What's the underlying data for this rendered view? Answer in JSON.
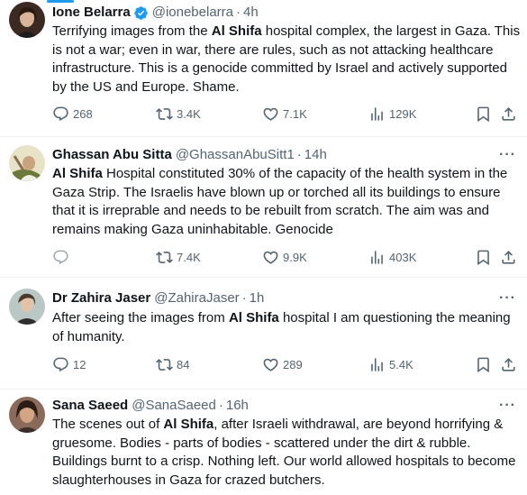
{
  "accent_color": "#1d9bf0",
  "text_color": "#0f1419",
  "secondary_color": "#536471",
  "tweets": [
    {
      "name": "Ione Belarra",
      "verified": true,
      "handle": "@ionebelarra",
      "sep": "·",
      "time": "4h",
      "more": "···",
      "body_parts": [
        {
          "t": "Terrifying images from the ",
          "b": false
        },
        {
          "t": "Al Shifa",
          "b": true
        },
        {
          "t": " hospital complex, the largest in Gaza. This is not a war; even in war, there are rules, such as not attacking healthcare infrastructure. This is a genocide committed by Israel and actively supported by the US and Europe. Shame.",
          "b": false
        }
      ],
      "replies": "268",
      "reposts": "3.4K",
      "likes": "7.1K",
      "views": "129K"
    },
    {
      "name": "Ghassan Abu Sitta",
      "verified": false,
      "handle": "@GhassanAbuSitt1",
      "sep": "·",
      "time": "14h",
      "more": "···",
      "body_parts": [
        {
          "t": "Al Shifa",
          "b": true
        },
        {
          "t": " Hospital constituted 30% of the capacity of the health system in the Gaza Strip. The Israelis have blown up or torched all its buildings to ensure that it is irreprable and needs to be rebuilt from scratch. The aim was and remains making Gaza uninhabitable. Genocide",
          "b": false
        }
      ],
      "replies": "",
      "reposts": "7.4K",
      "likes": "9.9K",
      "views": "403K"
    },
    {
      "name": "Dr Zahira Jaser",
      "verified": false,
      "handle": "@ZahiraJaser",
      "sep": "·",
      "time": "1h",
      "more": "···",
      "body_parts": [
        {
          "t": "After seeing the images from ",
          "b": false
        },
        {
          "t": "Al Shifa",
          "b": true
        },
        {
          "t": " hospital I am questioning the meaning of humanity.",
          "b": false
        }
      ],
      "replies": "12",
      "reposts": "84",
      "likes": "289",
      "views": "5.4K"
    },
    {
      "name": "Sana Saeed",
      "verified": false,
      "handle": "@SanaSaeed",
      "sep": "·",
      "time": "16h",
      "more": "···",
      "body_parts": [
        {
          "t": "The scenes out of ",
          "b": false
        },
        {
          "t": "Al Shifa",
          "b": true
        },
        {
          "t": ", after Israeli withdrawal, are beyond horrifying & gruesome. Bodies - parts of bodies - scattered under the dirt & rubble. Buildings burnt to a crisp. Nothing left. Our world allowed hospitals to become slaughterhouses in Gaza for crazed butchers.",
          "b": false
        }
      ]
    }
  ]
}
